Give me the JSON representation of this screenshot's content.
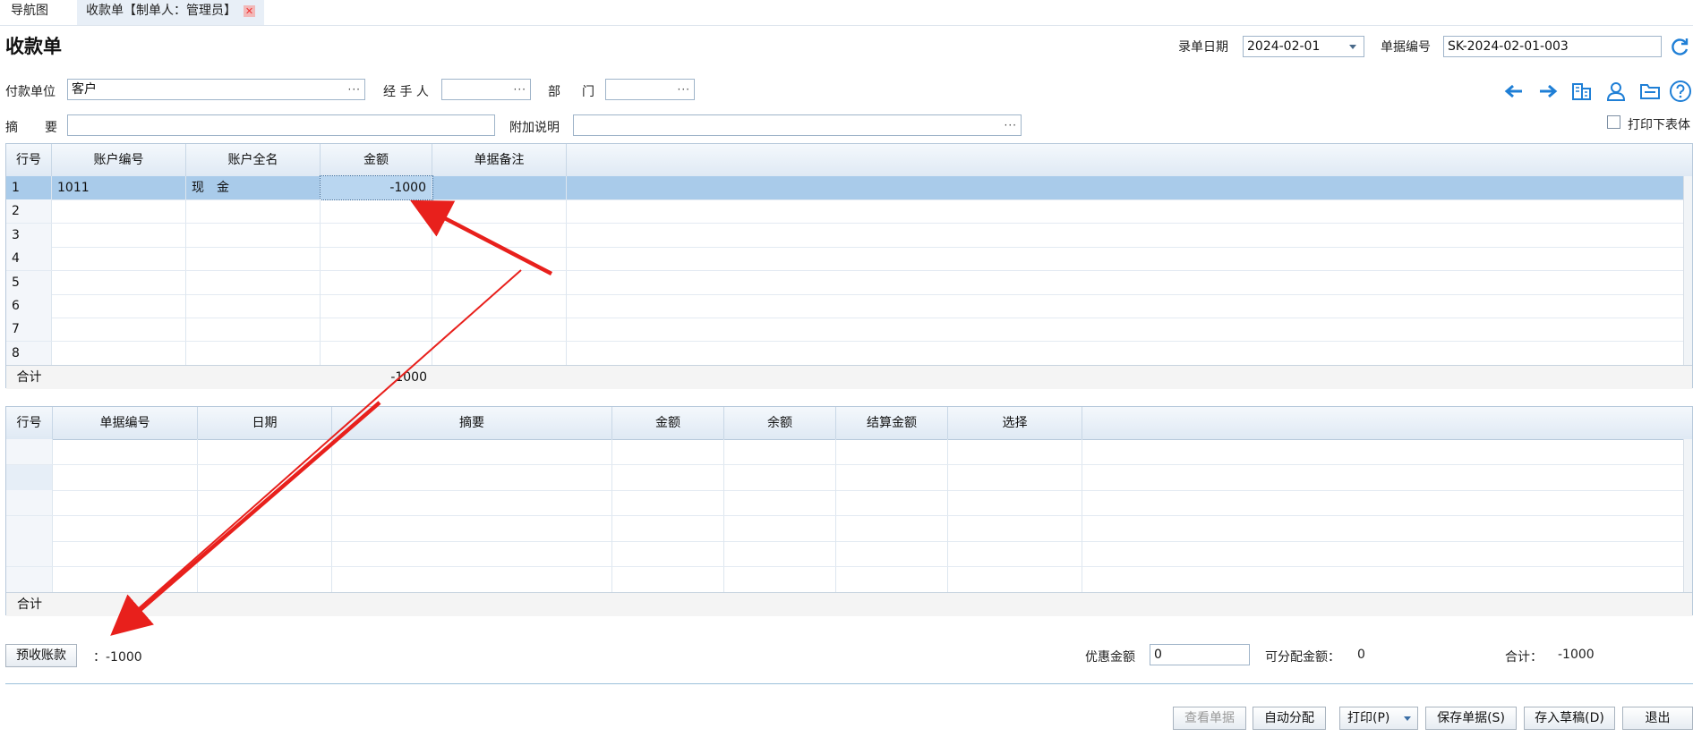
{
  "tabs": [
    {
      "label": "导航图",
      "active": false
    },
    {
      "label": "收款单【制单人：管理员】",
      "active": true
    }
  ],
  "page_title": "收款单",
  "header": {
    "date_label": "录单日期",
    "date_value": "2024-02-01",
    "number_label": "单据编号",
    "number_value": "SK-2024-02-01-003"
  },
  "form": {
    "payer_label": "付款单位",
    "payer_value": "客户",
    "handler_label": "经 手 人",
    "handler_value": "",
    "dept_label_1": "部",
    "dept_label_2": "门",
    "dept_value": "",
    "summary_label_1": "摘",
    "summary_label_2": "要",
    "summary_value": "",
    "note_label": "附加说明",
    "note_value": "",
    "print_body_label": "打印下表体"
  },
  "toolbar_icons": [
    "arrow-left-icon",
    "arrow-right-icon",
    "building-icon",
    "user-icon",
    "folder-icon",
    "help-icon"
  ],
  "top_grid": {
    "columns": [
      "行号",
      "账户编号",
      "账户全名",
      "金额",
      "单据备注"
    ],
    "rows": [
      {
        "n": "1",
        "account_no": "1011",
        "account_name": "现　金",
        "amount": "-1000",
        "remark": ""
      },
      {
        "n": "2",
        "account_no": "",
        "account_name": "",
        "amount": "",
        "remark": ""
      },
      {
        "n": "3",
        "account_no": "",
        "account_name": "",
        "amount": "",
        "remark": ""
      },
      {
        "n": "4",
        "account_no": "",
        "account_name": "",
        "amount": "",
        "remark": ""
      },
      {
        "n": "5",
        "account_no": "",
        "account_name": "",
        "amount": "",
        "remark": ""
      },
      {
        "n": "6",
        "account_no": "",
        "account_name": "",
        "amount": "",
        "remark": ""
      },
      {
        "n": "7",
        "account_no": "",
        "account_name": "",
        "amount": "",
        "remark": ""
      },
      {
        "n": "8",
        "account_no": "",
        "account_name": "",
        "amount": "",
        "remark": ""
      }
    ],
    "total_label": "合计",
    "total_amount": "-1000"
  },
  "bottom_grid": {
    "columns": [
      "行号",
      "单据编号",
      "日期",
      "摘要",
      "金额",
      "余额",
      "结算金额",
      "选择"
    ],
    "total_label": "合计"
  },
  "footer": {
    "prepay_button": "预收账款",
    "prepay_value": "：-1000",
    "discount_label": "优惠金额",
    "discount_value": "0",
    "allocatable_label": "可分配金额：",
    "allocatable_value": "0",
    "total_label": "合计：",
    "total_value": "-1000"
  },
  "actions": {
    "view_doc": "查看单据",
    "auto_alloc": "自动分配",
    "print": "打印(P)",
    "save": "保存单据(S)",
    "draft": "存入草稿(D)",
    "exit": "退出"
  },
  "colors": {
    "accent": "#1f7fd6",
    "selected_row": "#a9cbea",
    "annotation_arrow": "#e8201c"
  }
}
